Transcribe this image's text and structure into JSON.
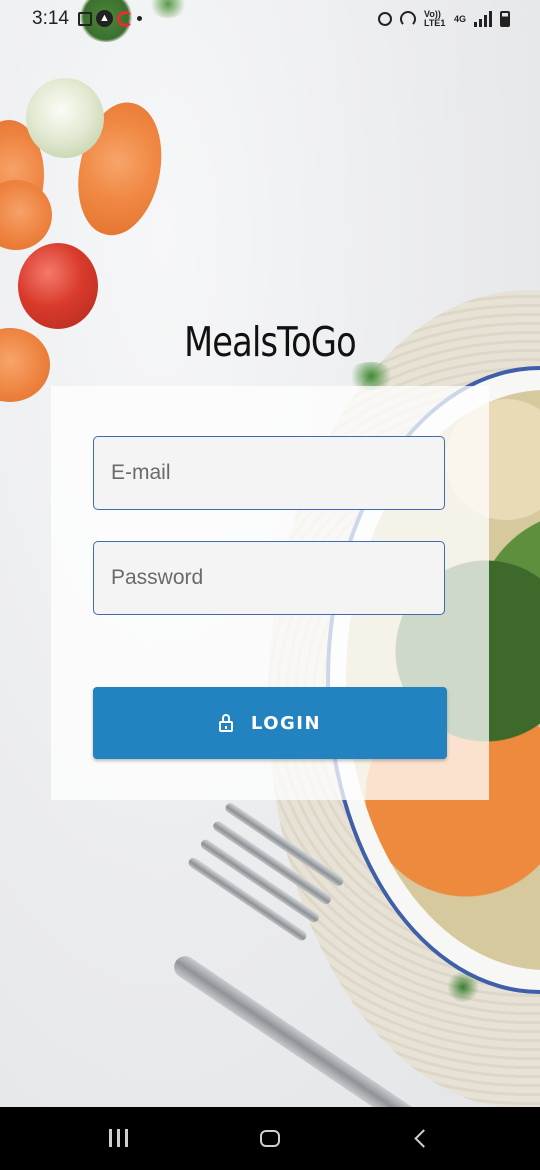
{
  "status_bar": {
    "time": "3:14",
    "left_icons": [
      "gallery-icon",
      "app-icon",
      "airtel-icon",
      "notification-dot-icon"
    ],
    "right_icons": [
      "alarm-icon",
      "hotspot-icon",
      "volte-icon",
      "4g-icon",
      "signal-icon",
      "battery-icon"
    ],
    "volte_label": "Vo)) LTE1",
    "network_label": "4G"
  },
  "app": {
    "title": "MealsToGo"
  },
  "login_form": {
    "email": {
      "value": "",
      "placeholder": "E-mail"
    },
    "password": {
      "value": "",
      "placeholder": "Password"
    },
    "login_button": {
      "label": "LOGIN",
      "icon": "lock-icon"
    }
  },
  "navigation_bar": {
    "buttons": [
      "recents",
      "home",
      "back"
    ]
  },
  "colors": {
    "accent": "#2382c0",
    "field_border": "#3d6cb3",
    "title_text": "#111111"
  }
}
